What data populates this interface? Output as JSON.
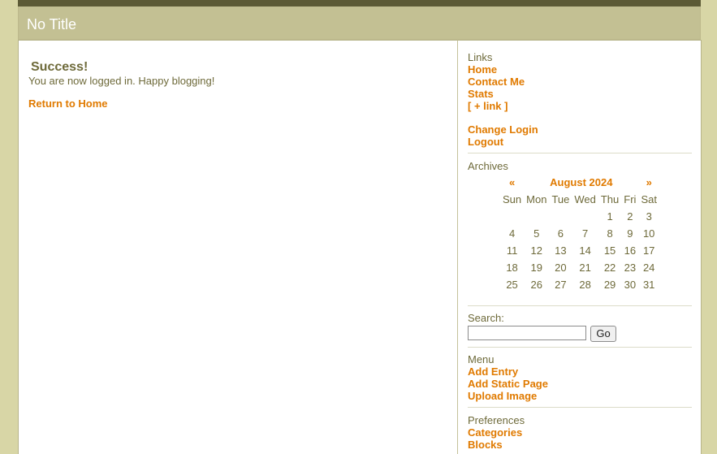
{
  "page": {
    "title": "No Title"
  },
  "main": {
    "success_heading": "Success!",
    "message": "You are now logged in. Happy blogging!",
    "return_link": "Return to Home"
  },
  "links": {
    "header": "Links",
    "items": [
      "Home",
      "Contact Me",
      "Stats",
      "[ + link ]"
    ]
  },
  "account": {
    "items": [
      "Change Login",
      "Logout"
    ]
  },
  "archives": {
    "header": "Archives",
    "prev": "«",
    "next": "»",
    "month": "August 2024",
    "weekdays": [
      "Sun",
      "Mon",
      "Tue",
      "Wed",
      "Thu",
      "Fri",
      "Sat"
    ],
    "weeks": [
      [
        "",
        "",
        "",
        "",
        "1",
        "2",
        "3"
      ],
      [
        "4",
        "5",
        "6",
        "7",
        "8",
        "9",
        "10"
      ],
      [
        "11",
        "12",
        "13",
        "14",
        "15",
        "16",
        "17"
      ],
      [
        "18",
        "19",
        "20",
        "21",
        "22",
        "23",
        "24"
      ],
      [
        "25",
        "26",
        "27",
        "28",
        "29",
        "30",
        "31"
      ]
    ]
  },
  "search": {
    "label": "Search:",
    "value": "",
    "button": "Go"
  },
  "menu": {
    "header": "Menu",
    "items": [
      "Add Entry",
      "Add Static Page",
      "Upload Image"
    ]
  },
  "preferences": {
    "header": "Preferences",
    "items": [
      "Categories",
      "Blocks"
    ]
  },
  "colors": {
    "background": "#d8d6a6",
    "title_bar": "#c3c093",
    "link": "#e07a00",
    "text": "#6e6a3a"
  }
}
